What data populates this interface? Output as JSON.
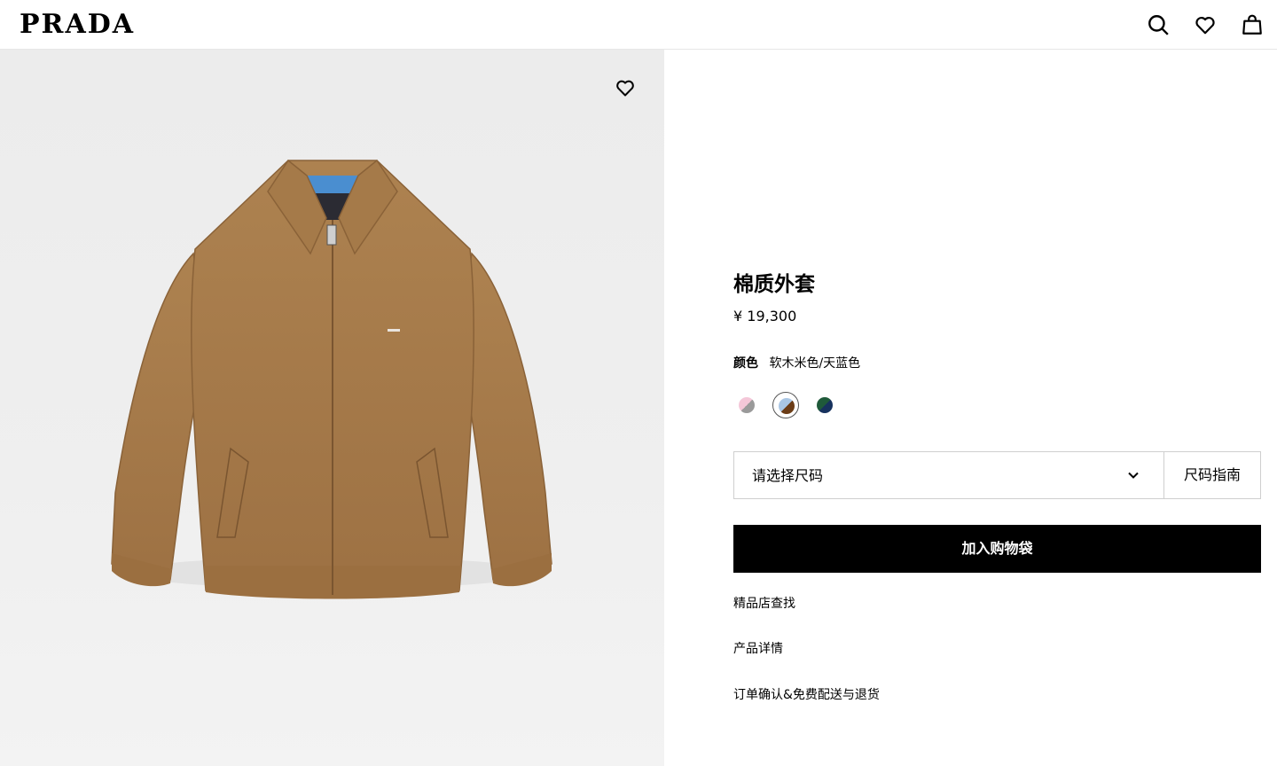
{
  "header": {
    "brand": "PRADA",
    "icons": [
      "search-icon",
      "heart-icon",
      "bag-icon"
    ]
  },
  "product": {
    "title": "棉质外套",
    "price": "¥ 19,300",
    "color_label": "颜色",
    "color_value": "软木米色/天蓝色",
    "swatches": [
      {
        "name": "pink-gray",
        "colors": [
          "#f4c7d8",
          "#9a9a9a"
        ],
        "selected": false
      },
      {
        "name": "blue-brown",
        "colors": [
          "#a9c6e4",
          "#6b3c16"
        ],
        "selected": true
      },
      {
        "name": "green-navy",
        "colors": [
          "#1f5a3a",
          "#17325e"
        ],
        "selected": false
      }
    ],
    "size_placeholder": "请选择尺码",
    "size_guide": "尺码指南",
    "add_to_bag": "加入购物袋",
    "links": [
      "精品店查找",
      "产品详情",
      "订单确认&免费配送与退货"
    ]
  },
  "colors": {
    "jacket": "#a97c4d",
    "collar_lining": "#4a8ed0",
    "button_bg": "#000000"
  }
}
